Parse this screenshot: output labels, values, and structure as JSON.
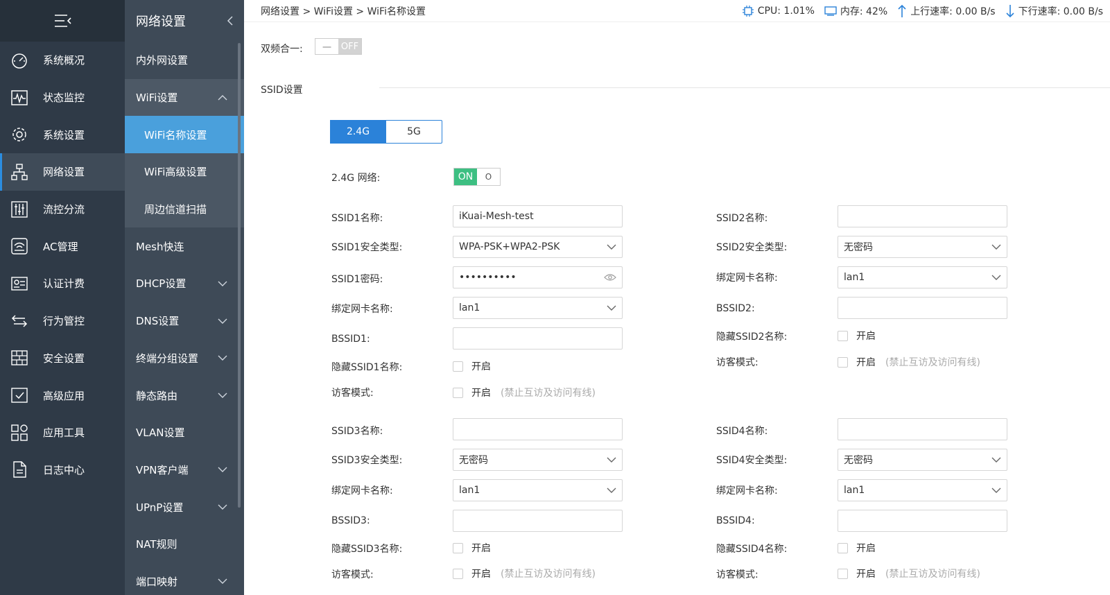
{
  "nav": {
    "items": [
      {
        "label": "系统概况",
        "icon": "gauge-icon"
      },
      {
        "label": "状态监控",
        "icon": "pulse-monitor-icon"
      },
      {
        "label": "系统设置",
        "icon": "gear-icon"
      },
      {
        "label": "网络设置",
        "icon": "network-tree-icon"
      },
      {
        "label": "流控分流",
        "icon": "sliders-icon"
      },
      {
        "label": "AC管理",
        "icon": "wifi-router-icon"
      },
      {
        "label": "认证计费",
        "icon": "id-card-icon"
      },
      {
        "label": "行为管控",
        "icon": "arrows-swap-icon"
      },
      {
        "label": "安全设置",
        "icon": "firewall-icon"
      },
      {
        "label": "高级应用",
        "icon": "check-screen-icon"
      },
      {
        "label": "应用工具",
        "icon": "tools-grid-icon"
      },
      {
        "label": "日志中心",
        "icon": "document-icon"
      }
    ]
  },
  "submenu": {
    "title": "网络设置",
    "items": [
      {
        "label": "内外网设置"
      },
      {
        "label": "WiFi设置"
      },
      {
        "label": "WiFi名称设置"
      },
      {
        "label": "WiFi高级设置"
      },
      {
        "label": "周边信道扫描"
      },
      {
        "label": "Mesh快连"
      },
      {
        "label": "DHCP设置"
      },
      {
        "label": "DNS设置"
      },
      {
        "label": "终端分组设置"
      },
      {
        "label": "静态路由"
      },
      {
        "label": "VLAN设置"
      },
      {
        "label": "VPN客户端"
      },
      {
        "label": "UPnP设置"
      },
      {
        "label": "NAT规则"
      },
      {
        "label": "端口映射"
      }
    ]
  },
  "breadcrumb": "网络设置 > WiFi设置 > WiFi名称设置",
  "stats": {
    "cpu": "CPU: 1.01%",
    "mem": "内存: 42%",
    "up": "上行速率: 0.00 B/s",
    "down": "下行速率: 0.00 B/s"
  },
  "dual_band": {
    "label": "双频合一:",
    "knob": "一",
    "state": "OFF"
  },
  "ssid_section_title": "SSID设置",
  "band_tabs": [
    "2.4G",
    "5G"
  ],
  "network": {
    "label": "2.4G 网络:",
    "state": "ON",
    "knob": "O"
  },
  "left_top": {
    "name_label": "SSID1名称:",
    "name_value": "iKuai-Mesh-test",
    "sec_label": "SSID1安全类型:",
    "sec_value": "WPA-PSK+WPA2-PSK",
    "pwd_label": "SSID1密码:",
    "pwd_value": "••••••••••",
    "nic_label": "绑定网卡名称:",
    "nic_value": "lan1",
    "bssid_label": "BSSID1:",
    "hide_label": "隐藏SSID1名称:",
    "hide_opt": "开启",
    "guest_label": "访客模式:",
    "guest_opt": "开启",
    "guest_hint": "(禁止互访及访问有线)"
  },
  "right_top": {
    "name_label": "SSID2名称:",
    "name_value": "",
    "sec_label": "SSID2安全类型:",
    "sec_value": "无密码",
    "nic_label": "绑定网卡名称:",
    "nic_value": "lan1",
    "bssid_label": "BSSID2:",
    "hide_label": "隐藏SSID2名称:",
    "hide_opt": "开启",
    "guest_label": "访客模式:",
    "guest_opt": "开启",
    "guest_hint": "(禁止互访及访问有线)"
  },
  "left_bottom": {
    "name_label": "SSID3名称:",
    "name_value": "",
    "sec_label": "SSID3安全类型:",
    "sec_value": "无密码",
    "nic_label": "绑定网卡名称:",
    "nic_value": "lan1",
    "bssid_label": "BSSID3:",
    "hide_label": "隐藏SSID3名称:",
    "hide_opt": "开启",
    "guest_label": "访客模式:",
    "guest_opt": "开启",
    "guest_hint": "(禁止互访及访问有线)"
  },
  "right_bottom": {
    "name_label": "SSID4名称:",
    "name_value": "",
    "sec_label": "SSID4安全类型:",
    "sec_value": "无密码",
    "nic_label": "绑定网卡名称:",
    "nic_value": "lan1",
    "bssid_label": "BSSID4:",
    "hide_label": "隐藏SSID4名称:",
    "hide_opt": "开启",
    "guest_label": "访客模式:",
    "guest_opt": "开启",
    "guest_hint": "(禁止互访及访问有线)"
  },
  "colors": {
    "nav_bg": "#2f3a47",
    "sub_bg": "#3e4a57",
    "selected": "#4aa0dc",
    "primary": "#2b82d9",
    "on_green": "#3dbf82"
  }
}
